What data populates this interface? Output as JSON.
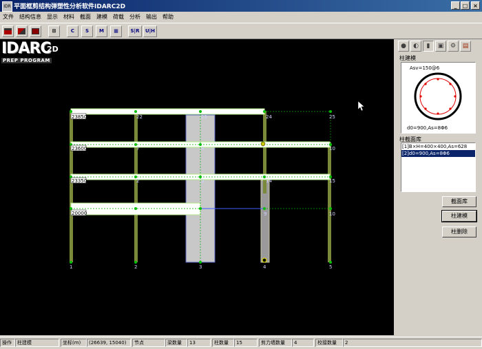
{
  "window": {
    "title": "平面框剪结构弹塑性分析软件IDARC2D",
    "icon_label": "IDR",
    "min": "_",
    "max": "□",
    "close": "×"
  },
  "menu": [
    "文件",
    "结构信息",
    "显示",
    "材料",
    "截面",
    "建模",
    "荷载",
    "分析",
    "输出",
    "帮助"
  ],
  "toolbar": [
    {
      "name": "save-icon",
      "label": ""
    },
    {
      "name": "edit-icon",
      "label": ""
    },
    {
      "name": "print-icon",
      "label": ""
    },
    {
      "name": "frame-icon",
      "label": ""
    },
    {
      "name": "c-icon",
      "label": "C"
    },
    {
      "name": "s-icon",
      "label": "S"
    },
    {
      "name": "m-icon",
      "label": "M"
    },
    {
      "name": "grid-icon",
      "label": "▦"
    },
    {
      "name": "sr-icon",
      "label": "S|R"
    },
    {
      "name": "uh-icon",
      "label": "U|H"
    }
  ],
  "logo": {
    "main": "IDARC",
    "suffix": "2D",
    "sub": "PREP PROGRAM"
  },
  "model": {
    "level_labels": [
      "23850",
      "23600",
      "23350",
      "20000"
    ],
    "node_labels": {
      "top": [
        "21",
        "22",
        "23",
        "24",
        "25"
      ],
      "l2": [
        "6",
        "7",
        "8",
        "",
        "10"
      ],
      "l3": [
        "1",
        "2",
        "3",
        "14",
        "15"
      ],
      "l4": [
        "",
        "",
        "",
        "9",
        "10"
      ],
      "base": [
        "1",
        "2",
        "3",
        "4",
        "5"
      ]
    }
  },
  "panel": {
    "tabs": [
      "●",
      "◐",
      "▮",
      "▣",
      "⚙",
      "▤"
    ],
    "column_model_title": "柱建模",
    "section_top_text": "Asv=150@6",
    "section_bottom_text": "d0=900,As=8Φ6",
    "library_title": "柱截面库",
    "library_items": [
      {
        "text": "[1]B×H=400×400,As=628",
        "selected": false
      },
      {
        "text": "[2]d0=900,As=8Φ6",
        "selected": true
      }
    ],
    "buttons": [
      "截面库",
      "柱建模",
      "柱删除"
    ]
  },
  "statusbar": {
    "op_label": "操作",
    "op_value": "柱建模",
    "coord_label": "坐标(m)",
    "coord_value": "(26639, 15040)",
    "node_label": "节点",
    "node_value": "",
    "beam_label": "梁数量",
    "beam_value": "13",
    "col_label": "柱数量",
    "col_value": "15",
    "wall_label": "剪力墙数量",
    "wall_value": "4",
    "link_label": "校接数量",
    "link_value": "2"
  },
  "colors": {
    "beam_fill": "#ffffff",
    "beam_edge": "#b4e888",
    "column": "#7a8a3a",
    "wall": "#c8c8c8",
    "node": "#00c000",
    "dash": "#00aa00"
  }
}
